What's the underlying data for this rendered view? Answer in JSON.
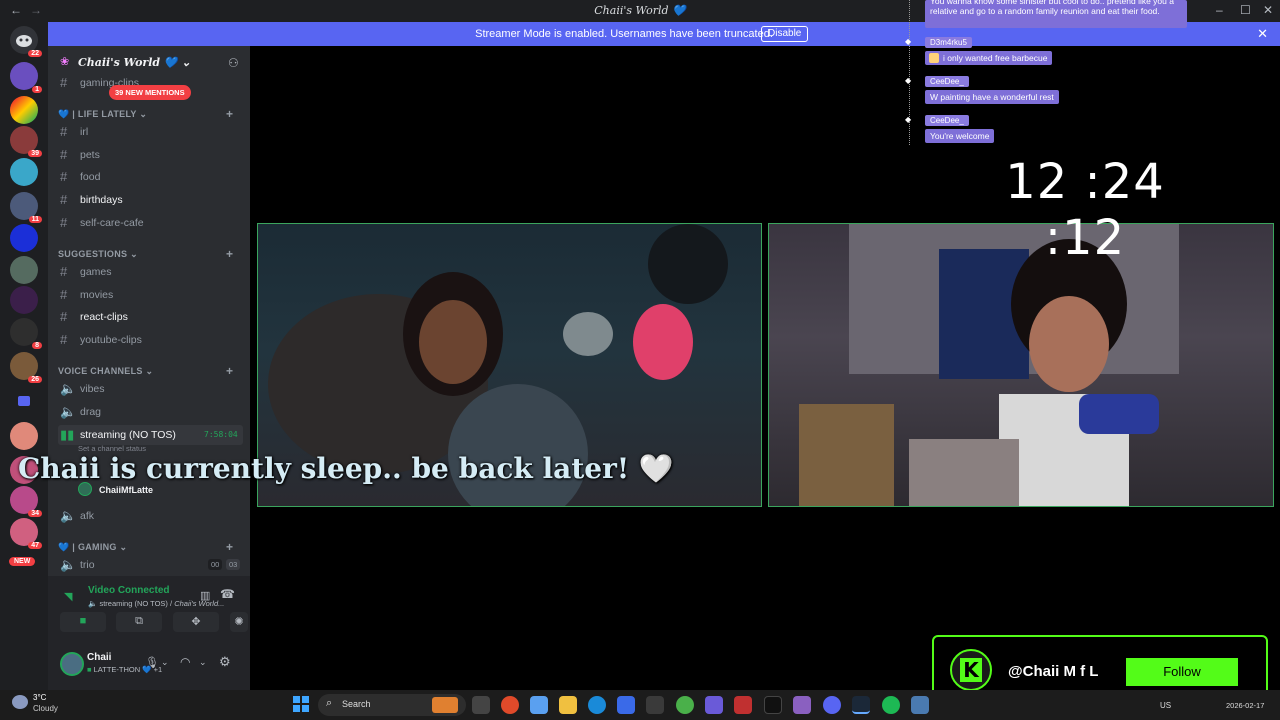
{
  "window": {
    "title": "Chaii's World 💙",
    "back": "←",
    "forward": "→",
    "controls": {
      "minimize": "–",
      "maximize": "☐",
      "close": "✕"
    }
  },
  "streamer_banner": {
    "text": "Streamer Mode is enabled. Usernames have been truncated.",
    "button": "Disable",
    "close": "✕"
  },
  "rail": {
    "home_badge": "22",
    "badges": [
      "1",
      "39",
      "11",
      "8",
      "26",
      "34",
      "47"
    ],
    "new_label": "NEW"
  },
  "server": {
    "name": "Chaii's World 💙",
    "mentions_pill": "39 NEW MENTIONS",
    "channels_top": [
      {
        "label": "gaming-clips"
      }
    ],
    "categories": [
      {
        "name": "💙 | LIFE LATELY",
        "channels": [
          {
            "label": "irl",
            "unread": false
          },
          {
            "label": "pets",
            "unread": false
          },
          {
            "label": "food",
            "unread": false
          },
          {
            "label": "birthdays",
            "unread": true
          },
          {
            "label": "self-care-cafe",
            "unread": false
          }
        ]
      },
      {
        "name": "SUGGESTIONS",
        "channels": [
          {
            "label": "games",
            "unread": false
          },
          {
            "label": "movies",
            "unread": false
          },
          {
            "label": "react-clips",
            "unread": true
          },
          {
            "label": "youtube-clips",
            "unread": false
          }
        ]
      },
      {
        "name": "VOICE CHANNELS",
        "channels": [
          {
            "label": "vibes"
          },
          {
            "label": "drag"
          }
        ]
      }
    ],
    "streaming_channel": {
      "label": "streaming (NO TOS)",
      "time": "7:58:04",
      "status": "Set a channel status",
      "member": "ChaiiMfLatte"
    },
    "afk_channel": "afk",
    "gaming_category": "GAMING",
    "trio_channel": {
      "label": "trio",
      "count_a": "00",
      "count_b": "03"
    }
  },
  "voice_panel": {
    "status": "Video Connected",
    "location_prefix": "streaming (NO TOS) / ",
    "location_server": "Chaii's World..."
  },
  "user_panel": {
    "name": "Chaii",
    "status": "LATTE-THON 💙 +1"
  },
  "overlay_chat": [
    {
      "user": "",
      "message": "You wanna know some sinister but cool to do.. pretend like you a relative and go to a random family reunion and eat their food."
    },
    {
      "user": "D3m4rku5",
      "message": "i only wanted free barbecue"
    },
    {
      "user": "CeeDee_",
      "message": "W painting have a wonderful rest"
    },
    {
      "user": "CeeDee_",
      "message": "You're welcome"
    }
  ],
  "clock": "12 :24 :12",
  "sleep_text": "Chaii is currently sleep.. be back later! 🤍",
  "kick_widget": {
    "handle": "@Chaii M f  L",
    "button": "Follow",
    "logo_letter": "K"
  },
  "taskbar": {
    "weather_temp": "3°C",
    "weather_desc": "Cloudy",
    "search_label": "Search",
    "lang": "US",
    "date": "2026-02-17"
  },
  "colors": {
    "discord_blurple": "#5865f2",
    "sidebar": "#2b2d31",
    "rail": "#1e1f22",
    "kick_green": "#53fc18",
    "video_border": "#3ba55d"
  }
}
